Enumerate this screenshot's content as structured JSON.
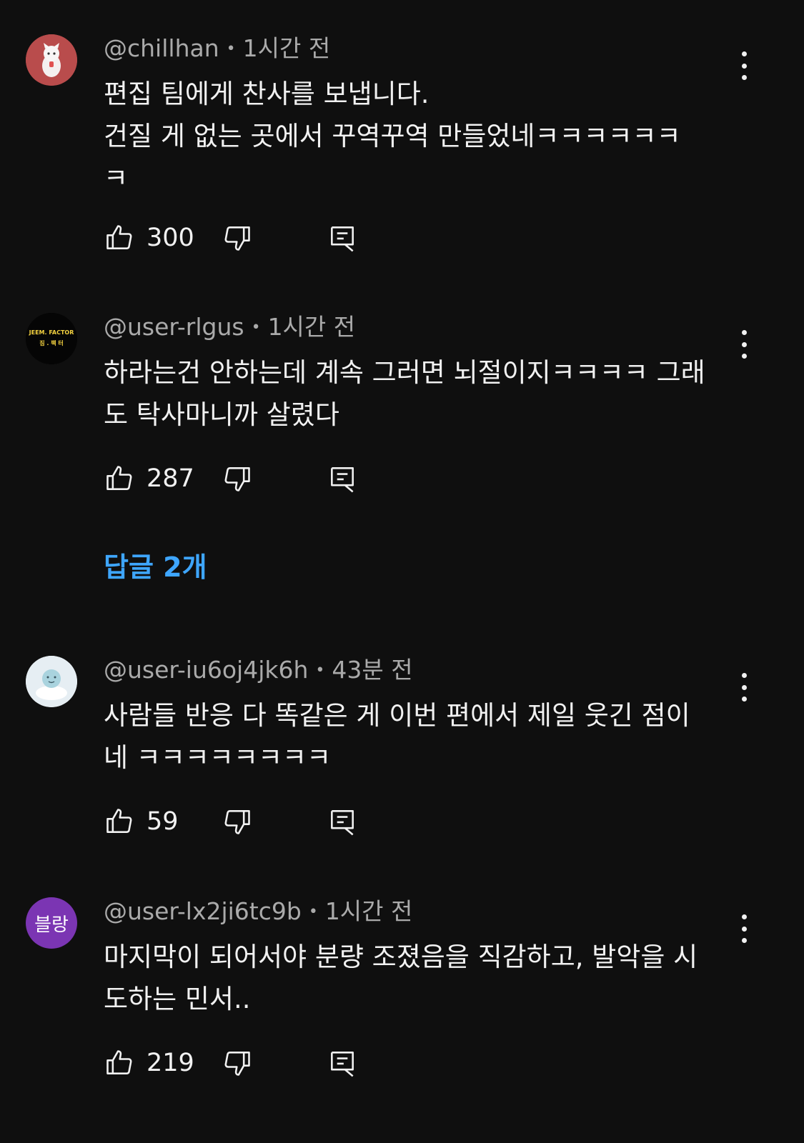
{
  "colors": {
    "background": "#0f0f0f",
    "text": "#f1f1f1",
    "meta": "#aaaaaa",
    "link": "#3ea6ff"
  },
  "comments": [
    {
      "author": "@chillhan",
      "time": "1시간 전",
      "text": "편집 팀에게 찬사를 보냅니다.\n 건질 게 없는 곳에서 꾸역꾸역 만들었네ㅋㅋㅋㅋㅋㅋ\nㅋ",
      "likes": "300",
      "avatar": "cat-avatar-icon"
    },
    {
      "author": "@user-rlgus",
      "time": "1시간 전",
      "text": "하라는건 안하는데 계속 그러면 뇌절이지ㅋㅋㅋㅋ 그래\n도 탁사마니까 살렸다",
      "likes": "287",
      "avatar_text_line1": "JEEM. FACTOR",
      "avatar_text_line2": "짐 . 팩 터",
      "replies_label": "답글 2개"
    },
    {
      "author": "@user-iu6oj4jk6h",
      "time": "43분 전",
      "text": "사람들 반응 다 똑같은 게 이번 편에서 제일 웃긴 점이\n네 ㅋㅋㅋㅋㅋㅋㅋㅋ",
      "likes": "59",
      "avatar": "cloud-character-icon"
    },
    {
      "author": "@user-lx2ji6tc9b",
      "time": "1시간 전",
      "text": "마지막이 되어서야 분량 조졌음을 직감하고, 발악을 시\n도하는 민서..",
      "likes": "219",
      "avatar_text": "블랑",
      "avatar_color": "#7b35b3"
    }
  ]
}
